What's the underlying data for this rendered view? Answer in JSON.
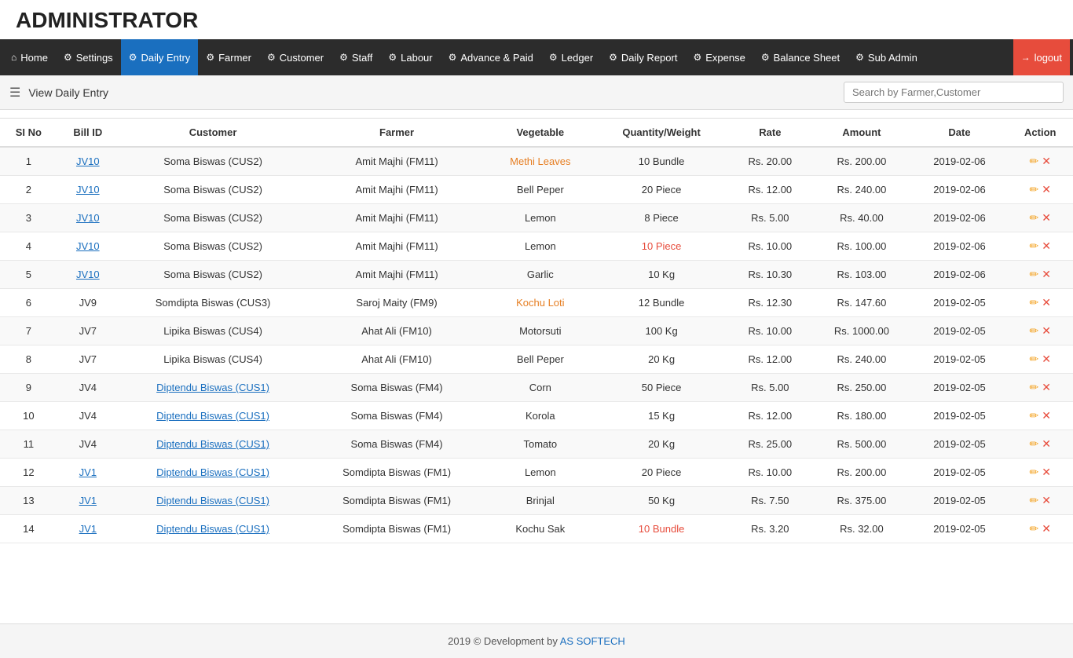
{
  "app": {
    "title": "ADMINISTRATOR"
  },
  "navbar": {
    "items": [
      {
        "id": "home",
        "label": "Home",
        "icon": "⌂",
        "active": false
      },
      {
        "id": "settings",
        "label": "Settings",
        "icon": "⚙",
        "active": false
      },
      {
        "id": "daily-entry",
        "label": "Daily Entry",
        "icon": "⚙",
        "active": true
      },
      {
        "id": "farmer",
        "label": "Farmer",
        "icon": "⚙",
        "active": false
      },
      {
        "id": "customer",
        "label": "Customer",
        "icon": "⚙",
        "active": false
      },
      {
        "id": "staff",
        "label": "Staff",
        "icon": "⚙",
        "active": false
      },
      {
        "id": "labour",
        "label": "Labour",
        "icon": "⚙",
        "active": false
      },
      {
        "id": "advance-paid",
        "label": "Advance & Paid",
        "icon": "⚙",
        "active": false
      },
      {
        "id": "ledger",
        "label": "Ledger",
        "icon": "⚙",
        "active": false
      },
      {
        "id": "daily-report",
        "label": "Daily Report",
        "icon": "⚙",
        "active": false
      },
      {
        "id": "expense",
        "label": "Expense",
        "icon": "⚙",
        "active": false
      },
      {
        "id": "balance-sheet",
        "label": "Balance Sheet",
        "icon": "⚙",
        "active": false
      },
      {
        "id": "sub-admin",
        "label": "Sub Admin",
        "icon": "⚙",
        "active": false
      },
      {
        "id": "logout",
        "label": "logout",
        "icon": "→",
        "active": false
      }
    ]
  },
  "toolbar": {
    "menu_label": "☰",
    "title": "View Daily Entry",
    "search_placeholder": "Search by Farmer,Customer"
  },
  "table": {
    "columns": [
      "SI No",
      "Bill ID",
      "Customer",
      "Farmer",
      "Vegetable",
      "Quantity/Weight",
      "Rate",
      "Amount",
      "Date",
      "Action"
    ],
    "rows": [
      {
        "si": 1,
        "bill_id": "JV10",
        "bill_link": true,
        "customer": "Soma Biswas (CUS2)",
        "customer_link": false,
        "farmer": "Amit Majhi (FM11)",
        "farmer_link": false,
        "vegetable": "Methi Leaves",
        "veg_highlight": "orange",
        "qty": "10 Bundle",
        "qty_highlight": false,
        "rate": "Rs. 20.00",
        "amount": "Rs. 200.00",
        "date": "2019-02-06"
      },
      {
        "si": 2,
        "bill_id": "JV10",
        "bill_link": true,
        "customer": "Soma Biswas (CUS2)",
        "customer_link": false,
        "farmer": "Amit Majhi (FM11)",
        "farmer_link": false,
        "vegetable": "Bell Peper",
        "veg_highlight": false,
        "qty": "20 Piece",
        "qty_highlight": false,
        "rate": "Rs. 12.00",
        "amount": "Rs. 240.00",
        "date": "2019-02-06"
      },
      {
        "si": 3,
        "bill_id": "JV10",
        "bill_link": true,
        "customer": "Soma Biswas (CUS2)",
        "customer_link": false,
        "farmer": "Amit Majhi (FM11)",
        "farmer_link": false,
        "vegetable": "Lemon",
        "veg_highlight": false,
        "qty": "8 Piece",
        "qty_highlight": false,
        "rate": "Rs. 5.00",
        "amount": "Rs. 40.00",
        "date": "2019-02-06"
      },
      {
        "si": 4,
        "bill_id": "JV10",
        "bill_link": true,
        "customer": "Soma Biswas (CUS2)",
        "customer_link": false,
        "farmer": "Amit Majhi (FM11)",
        "farmer_link": false,
        "vegetable": "Lemon",
        "veg_highlight": false,
        "qty": "10 Piece",
        "qty_highlight": "red",
        "rate": "Rs. 10.00",
        "amount": "Rs. 100.00",
        "date": "2019-02-06"
      },
      {
        "si": 5,
        "bill_id": "JV10",
        "bill_link": true,
        "customer": "Soma Biswas (CUS2)",
        "customer_link": false,
        "farmer": "Amit Majhi (FM11)",
        "farmer_link": false,
        "vegetable": "Garlic",
        "veg_highlight": false,
        "qty": "10 Kg",
        "qty_highlight": false,
        "rate": "Rs. 10.30",
        "amount": "Rs. 103.00",
        "date": "2019-02-06"
      },
      {
        "si": 6,
        "bill_id": "JV9",
        "bill_link": false,
        "customer": "Somdipta Biswas (CUS3)",
        "customer_link": false,
        "farmer": "Saroj Maity (FM9)",
        "farmer_link": false,
        "vegetable": "Kochu Loti",
        "veg_highlight": "orange",
        "qty": "12 Bundle",
        "qty_highlight": false,
        "rate": "Rs. 12.30",
        "amount": "Rs. 147.60",
        "date": "2019-02-05"
      },
      {
        "si": 7,
        "bill_id": "JV7",
        "bill_link": false,
        "customer": "Lipika Biswas (CUS4)",
        "customer_link": false,
        "farmer": "Ahat Ali (FM10)",
        "farmer_link": false,
        "vegetable": "Motorsuti",
        "veg_highlight": false,
        "qty": "100 Kg",
        "qty_highlight": false,
        "rate": "Rs. 10.00",
        "amount": "Rs. 1000.00",
        "date": "2019-02-05"
      },
      {
        "si": 8,
        "bill_id": "JV7",
        "bill_link": false,
        "customer": "Lipika Biswas (CUS4)",
        "customer_link": false,
        "farmer": "Ahat Ali (FM10)",
        "farmer_link": false,
        "vegetable": "Bell Peper",
        "veg_highlight": false,
        "qty": "20 Kg",
        "qty_highlight": false,
        "rate": "Rs. 12.00",
        "amount": "Rs. 240.00",
        "date": "2019-02-05"
      },
      {
        "si": 9,
        "bill_id": "JV4",
        "bill_link": false,
        "customer": "Diptendu Biswas (CUS1)",
        "customer_link": "blue",
        "farmer": "Soma Biswas (FM4)",
        "farmer_link": false,
        "vegetable": "Corn",
        "veg_highlight": false,
        "qty": "50 Piece",
        "qty_highlight": false,
        "rate": "Rs. 5.00",
        "amount": "Rs. 250.00",
        "date": "2019-02-05"
      },
      {
        "si": 10,
        "bill_id": "JV4",
        "bill_link": false,
        "customer": "Diptendu Biswas (CUS1)",
        "customer_link": "blue",
        "farmer": "Soma Biswas (FM4)",
        "farmer_link": false,
        "vegetable": "Korola",
        "veg_highlight": false,
        "qty": "15 Kg",
        "qty_highlight": false,
        "rate": "Rs. 12.00",
        "amount": "Rs. 180.00",
        "date": "2019-02-05"
      },
      {
        "si": 11,
        "bill_id": "JV4",
        "bill_link": false,
        "customer": "Diptendu Biswas (CUS1)",
        "customer_link": "blue",
        "farmer": "Soma Biswas (FM4)",
        "farmer_link": false,
        "vegetable": "Tomato",
        "veg_highlight": false,
        "qty": "20 Kg",
        "qty_highlight": false,
        "rate": "Rs. 25.00",
        "amount": "Rs. 500.00",
        "date": "2019-02-05"
      },
      {
        "si": 12,
        "bill_id": "JV1",
        "bill_link": "blue",
        "customer": "Diptendu Biswas (CUS1)",
        "customer_link": "blue",
        "farmer": "Somdipta Biswas (FM1)",
        "farmer_link": false,
        "vegetable": "Lemon",
        "veg_highlight": false,
        "qty": "20 Piece",
        "qty_highlight": false,
        "rate": "Rs. 10.00",
        "amount": "Rs. 200.00",
        "date": "2019-02-05"
      },
      {
        "si": 13,
        "bill_id": "JV1",
        "bill_link": "blue",
        "customer": "Diptendu Biswas (CUS1)",
        "customer_link": "blue",
        "farmer": "Somdipta Biswas (FM1)",
        "farmer_link": false,
        "vegetable": "Brinjal",
        "veg_highlight": false,
        "qty": "50 Kg",
        "qty_highlight": false,
        "rate": "Rs. 7.50",
        "amount": "Rs. 375.00",
        "date": "2019-02-05"
      },
      {
        "si": 14,
        "bill_id": "JV1",
        "bill_link": "blue",
        "customer": "Diptendu Biswas (CUS1)",
        "customer_link": "blue",
        "farmer": "Somdipta Biswas (FM1)",
        "farmer_link": false,
        "vegetable": "Kochu Sak",
        "veg_highlight": false,
        "qty": "10 Bundle",
        "qty_highlight": "red",
        "rate": "Rs. 3.20",
        "amount": "Rs. 32.00",
        "date": "2019-02-05"
      }
    ]
  },
  "footer": {
    "text": "2019 © Development by ",
    "link_text": "AS SOFTECH",
    "link_url": "#"
  }
}
